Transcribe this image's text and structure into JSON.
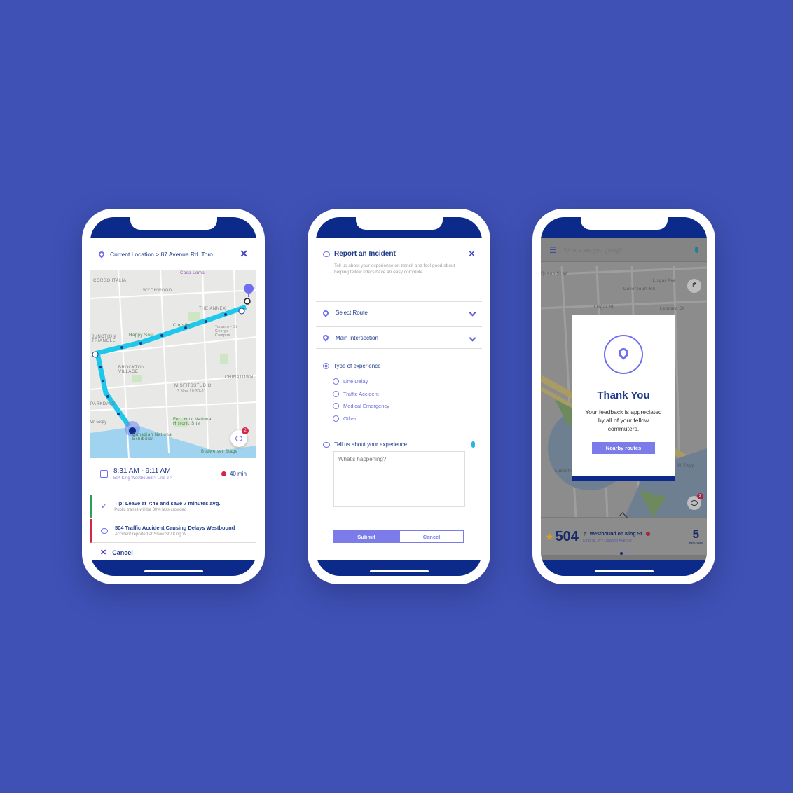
{
  "phone1": {
    "header": {
      "location_text": "Current Location > 87 Avenue Rd. Toro..."
    },
    "map_labels": [
      "CORSO ITALIA",
      "Casa Loma",
      "WYCHWOOD",
      "THE ANNEX",
      "Christie",
      "Toronto - St George Campus",
      "JUNCTION TRIANGLE",
      "Happy Soul",
      "BROCKTON VILLAGE",
      "MISFITSSTUDIO",
      "3 Nov 10:30-01",
      "CHINATOWN",
      "PARKDALE",
      "Fort York National Historic Site",
      "Canadian National Exhibition",
      "Budweiser Stage",
      "W Expy"
    ],
    "chat_badge": "2",
    "trip": {
      "time": "8:31 AM - 9:11 AM",
      "route_detail": "504 King Westbound >",
      "line": "Line 2 >",
      "duration": "40 min"
    },
    "tip": {
      "title": "Tip: Leave at 7:48 and save 7 minutes avg.",
      "subtitle": "Public transit will be 30% less crowded"
    },
    "incident": {
      "title": "504 Traffic Accident Causing Delays Westbound",
      "subtitle": "Accident reported at Shaw St / King W"
    },
    "cancel_label": "Cancel",
    "colors": {
      "route": "#1ec8ea",
      "tip": "#2e9e5b",
      "incident": "#d6254a"
    }
  },
  "phone2": {
    "title": "Report an Incident",
    "description": "Tell us about your experience on transit and feel good about helping fellow riders have an easy commute.",
    "select_route": "Select Route",
    "main_intersection": "Main Intersection",
    "type_label": "Type of experience",
    "options": [
      "Line Delay",
      "Traffic Accident",
      "Medical Emergency",
      "Other"
    ],
    "tell_label": "Tell us about your experience",
    "textarea_placeholder": "What's happening?",
    "submit_label": "Submit",
    "cancel_label": "Cancel"
  },
  "phone3": {
    "search_placeholder": "Where are you going?",
    "map_labels": [
      "Queen St W",
      "Lisgar St",
      "Dovercourt Rd",
      "Lisgar Ave",
      "Lakeshore Blvd",
      "Leonard St",
      "W Expy"
    ],
    "modal": {
      "title": "Thank You",
      "message": "Your feedback is appreciated by all of your fellow commuters.",
      "button": "Nearby routes"
    },
    "chat_badge": "2",
    "bottom": {
      "route_number": "504",
      "direction": "Westbound on King St.",
      "stop": "King St. W / Dowling Avenue",
      "minutes": "5",
      "minutes_label": "minutes"
    }
  }
}
